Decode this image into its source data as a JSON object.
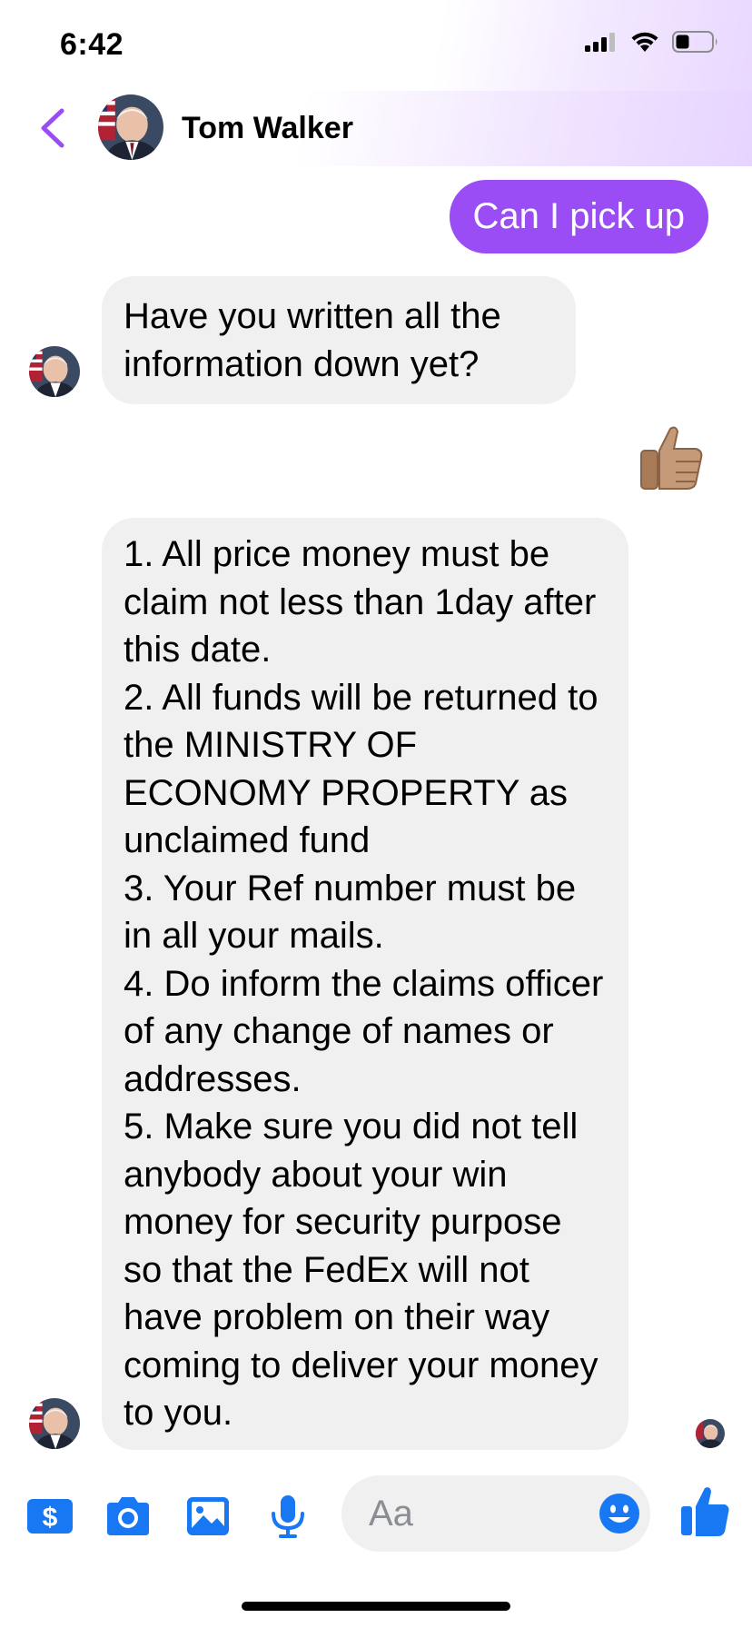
{
  "status_bar": {
    "time": "6:42"
  },
  "header": {
    "contact_name": "Tom Walker"
  },
  "messages": [
    {
      "direction": "outgoing",
      "text": "Can I pick up"
    },
    {
      "direction": "incoming",
      "text": "Have you written all the information down yet?"
    },
    {
      "direction": "outgoing",
      "type": "emoji",
      "icon": "thumbs-up-icon"
    },
    {
      "direction": "incoming",
      "text": "1. All price money must be claim not less than 1day after this date.\n2. All funds will be returned to the MINISTRY OF ECONOMY PROPERTY as unclaimed fund\n3. Your Ref number must be in all your mails.\n4. Do inform the claims officer of any change of names or addresses.\n5. Make sure you did not tell anybody about your win money for security purpose so that the FedEx will not have problem on their way coming to deliver your money to you."
    }
  ],
  "composer": {
    "placeholder": "Aa",
    "icons": [
      "dollar-icon",
      "camera-icon",
      "photo-icon",
      "microphone-icon",
      "emoji-icon",
      "like-icon"
    ]
  },
  "colors": {
    "accent": "#9b4df5",
    "composer_blue": "#1877f2",
    "bubble_gray": "#f0f0f0"
  }
}
